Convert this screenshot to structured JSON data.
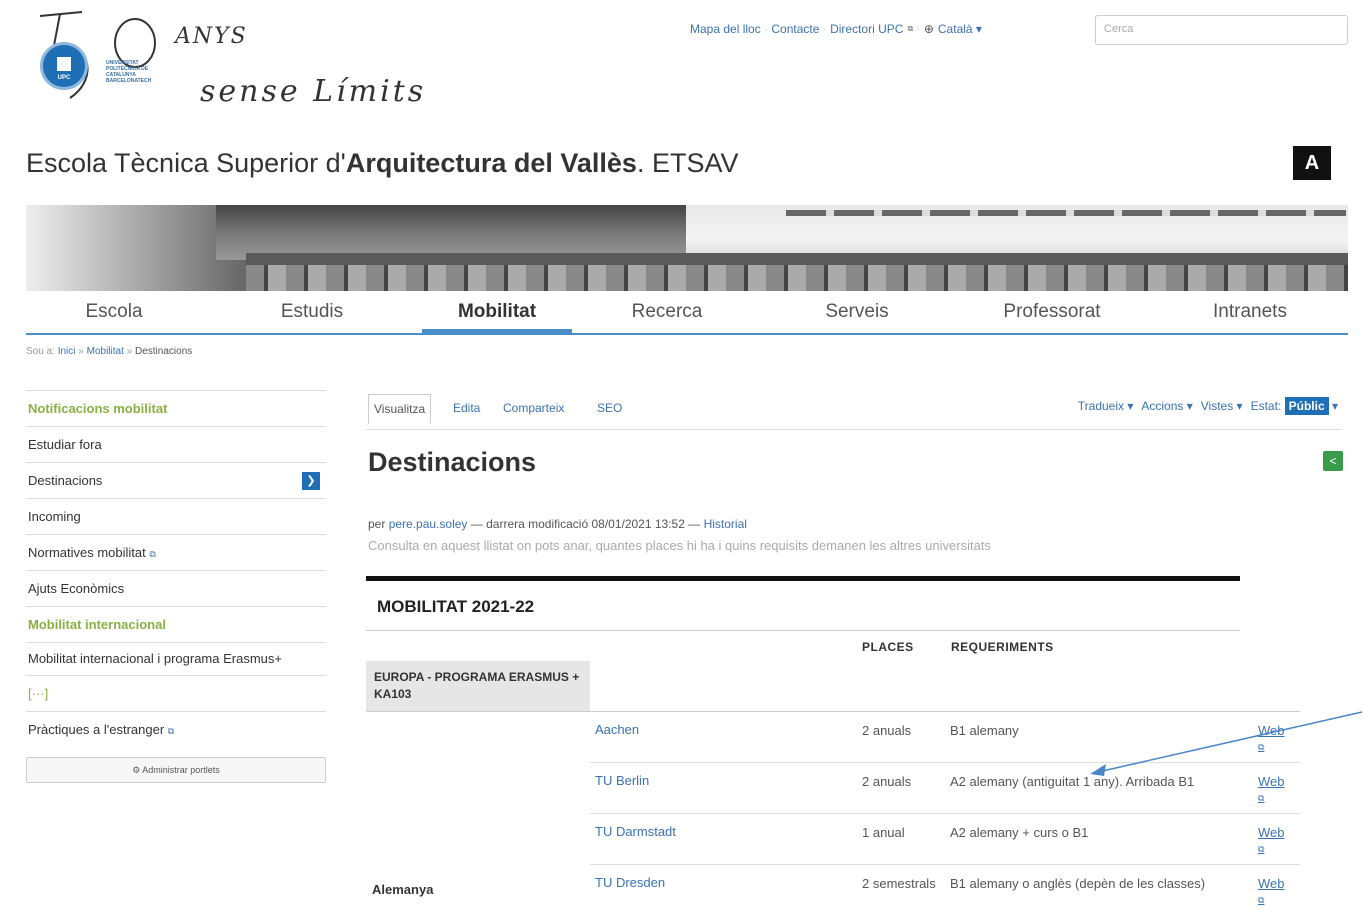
{
  "header": {
    "logo_anys": "ANYS",
    "logo_sense": "sense Límits",
    "logo_upc": "UNIVERSITAT POLITÈCNICA DE CATALUNYA BARCELONATECH",
    "logo_upc_short": "UPC",
    "toplinks": [
      "Mapa del lloc",
      "Contacte",
      "Directori UPC",
      "Català ▾"
    ],
    "search_placeholder": "Cerca"
  },
  "school": {
    "title_prefix": "Escola Tècnica Superior d'",
    "title_bold": "Arquitectura del Vallès",
    "title_suffix": ". ETSAV",
    "logo": "A"
  },
  "nav": {
    "items": [
      "Escola",
      "Estudis",
      "Mobilitat",
      "Recerca",
      "Serveis",
      "Professorat",
      "Intranets"
    ],
    "active": "Mobilitat"
  },
  "breadcrumb": {
    "prefix": "Sou a:",
    "items": [
      "Inici",
      "Mobilitat",
      "Destinacions"
    ],
    "sep": "»"
  },
  "sidebar": {
    "items": [
      {
        "label": "Notificacions mobilitat",
        "style": "green"
      },
      {
        "label": "Estudiar fora",
        "style": "normal"
      },
      {
        "label": "Destinacions",
        "style": "normal"
      },
      {
        "label": "Incoming",
        "style": "normal"
      },
      {
        "label": "Normatives mobilitat",
        "style": "normal"
      },
      {
        "label": "Ajuts Econòmics",
        "style": "normal"
      },
      {
        "label": "Mobilitat internacional",
        "style": "green"
      },
      {
        "label": "Mobilitat internacional i programa Erasmus+",
        "style": "normal"
      },
      {
        "label": "[···]",
        "style": "green"
      },
      {
        "label": "Pràctiques a l'estranger",
        "style": "normal"
      }
    ],
    "admin_label": "⚙ Administrar portlets"
  },
  "editbar": {
    "tabs": [
      "Visualitza",
      "Edita",
      "Comparteix",
      "SEO"
    ],
    "right": [
      "Tradueix ▾",
      "Accions ▾",
      "Vistes ▾"
    ],
    "estat_label": "Estat:",
    "estat_value": "Públic"
  },
  "content": {
    "title": "Destinacions",
    "byline_prefix": "per",
    "author": "pere.pau.soley",
    "modified": "— darrera modificació 08/01/2021 13:52 —",
    "history": "Historial",
    "description": "Consulta en aquest llistat on pots anar, quantes places hi ha i quins requisits demanen les altres universitats",
    "section": "MOBILITAT 2021-22",
    "col_places": "PLACES",
    "col_req": "REQUERIMENTS",
    "region": "EUROPA - PROGRAMA ERASMUS + KA103",
    "country": "Alemanya",
    "rows": [
      {
        "uni": "Aachen",
        "places": "2 anuals",
        "req": "B1 alemany",
        "web": "Web"
      },
      {
        "uni": "TU Berlin",
        "places": "2 anuals",
        "req": "A2 alemany (antiguitat 1 any). Arribada B1",
        "web": "Web"
      },
      {
        "uni": "TU Darmstadt",
        "places": "1 anual",
        "req": "A2 alemany + curs o B1",
        "web": "Web"
      },
      {
        "uni": "TU Dresden",
        "places": "2 semestrals",
        "req": "B1 alemany o anglès (depèn de les classes)",
        "web": "Web"
      }
    ]
  },
  "colors": {
    "link": "#3b72b0",
    "accent_blue": "#1e6fb5",
    "green": "#8ab043",
    "annotation_arrow": "#4a86c8"
  }
}
